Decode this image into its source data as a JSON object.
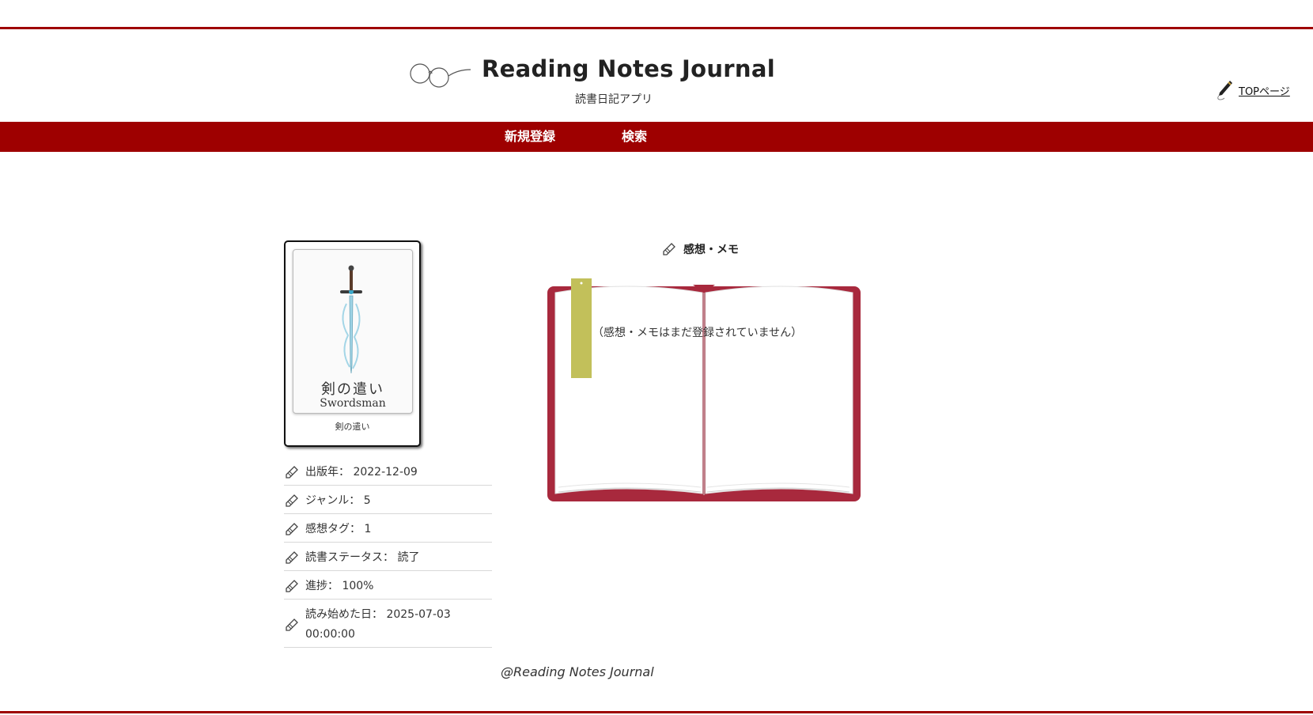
{
  "header": {
    "title": "Reading Notes Journal",
    "subtitle": "読書日記アプリ",
    "top_link": "TOPページ"
  },
  "nav": {
    "new_label": "新規登録",
    "search_label": "検索"
  },
  "book": {
    "cover_title_jp": "剣の遣い",
    "cover_title_en": "Swordsman",
    "caption": "剣の遣い"
  },
  "details": [
    {
      "label": "出版年：",
      "value": "2022-12-09"
    },
    {
      "label": "ジャンル：",
      "value": "5"
    },
    {
      "label": "感想タグ：",
      "value": "1"
    },
    {
      "label": "読書ステータス：",
      "value": "読了"
    },
    {
      "label": "進捗：",
      "value": "100%"
    },
    {
      "label": "読み始めた日：",
      "value": "2025-07-03 00:00:00"
    }
  ],
  "memo": {
    "heading": "感想・メモ",
    "empty_text": "（感想・メモはまだ登録されていません）"
  },
  "footer": {
    "text": "@Reading Notes Journal"
  },
  "colors": {
    "brand_red": "#9e0000",
    "book_cover": "#a8293d",
    "bookmark": "#c2c05a"
  }
}
